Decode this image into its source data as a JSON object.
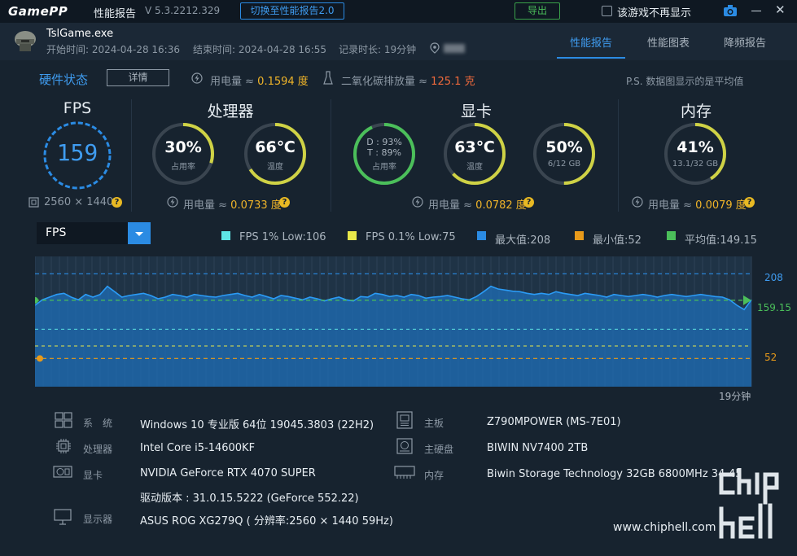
{
  "titlebar": {
    "logo": "GamePP",
    "title": "性能报告",
    "version": "V 5.3.2212.329",
    "switch_label": "切换至性能报告2.0",
    "export_label": "导出",
    "no_show_label": "该游戏不再显示"
  },
  "game": {
    "name": "TslGame.exe",
    "start": "开始时间: 2024-04-28 16:36",
    "end": "结束时间: 2024-04-28 16:55",
    "duration": "记录时长: 19分钟"
  },
  "tabs": [
    "性能报告",
    "性能图表",
    "降频报告"
  ],
  "summary": {
    "hw_title": "硬件状态",
    "detail_label": "详情",
    "power_label": "用电量 ≈",
    "power_value": "0.1594 度",
    "co2_label": "二氧化碳排放量 ≈",
    "co2_value": "125.1 克",
    "note": "P.S. 数据图显示的是平均值"
  },
  "fps": {
    "title": "FPS",
    "value": "159",
    "resolution": "2560 × 1440"
  },
  "cpu": {
    "title": "处理器",
    "usage_value": "30%",
    "usage_label": "占用率",
    "usage_pct": 30,
    "temp_value": "66℃",
    "temp_label": "温度",
    "temp_pct": 66,
    "energy_label": "用电量 ≈",
    "energy_value": "0.0733 度"
  },
  "gpu": {
    "title": "显卡",
    "d_line": "D : 93%",
    "t_line": "T : 89%",
    "usage_label": "占用率",
    "d_pct": 93,
    "t_pct": 89,
    "temp_value": "63℃",
    "temp_label": "温度",
    "temp_pct": 63,
    "vram_value": "50%",
    "vram_label": "6/12 GB",
    "vram_pct": 50,
    "energy_label": "用电量 ≈",
    "energy_value": "0.0782 度"
  },
  "mem": {
    "title": "内存",
    "value": "41%",
    "label": "13.1/32 GB",
    "pct": 41,
    "energy_label": "用电量 ≈",
    "energy_value": "0.0079 度"
  },
  "chart_panel": {
    "dropdown": "FPS",
    "legend": [
      {
        "label": "FPS 1% Low:106",
        "color": "#5ee6e6"
      },
      {
        "label": "FPS 0.1% Low:75",
        "color": "#e8e84a"
      },
      {
        "label": "最大值:208",
        "color": "#2b8be3"
      },
      {
        "label": "最小值:52",
        "color": "#e89a1a"
      },
      {
        "label": "平均值:149.15",
        "color": "#4bbf5a"
      }
    ],
    "max_label": "208",
    "avg_label": "159.15",
    "min_label": "52",
    "duration_label": "19分钟"
  },
  "chart_data": {
    "type": "area",
    "series": [
      {
        "name": "FPS",
        "values": [
          150,
          160,
          165,
          170,
          172,
          165,
          160,
          170,
          165,
          170,
          185,
          175,
          165,
          168,
          170,
          172,
          168,
          162,
          165,
          170,
          168,
          165,
          170,
          168,
          166,
          165,
          168,
          170,
          172,
          168,
          165,
          170,
          166,
          162,
          168,
          166,
          163,
          160,
          165,
          162,
          158,
          162,
          165,
          160,
          158,
          166,
          165,
          172,
          170,
          166,
          168,
          165,
          170,
          168,
          163,
          165,
          166,
          168,
          165,
          162,
          160,
          166,
          175,
          185,
          180,
          178,
          176,
          175,
          172,
          170,
          172,
          170,
          175,
          172,
          170,
          168,
          172,
          170,
          168,
          165,
          170,
          168,
          166,
          168,
          170,
          168,
          165,
          168,
          170,
          168,
          166,
          168,
          170,
          168,
          166,
          165,
          160,
          150,
          142,
          160
        ]
      }
    ],
    "reference_lines": {
      "max": 208,
      "avg": 159.15,
      "min": 52,
      "low_1": 106,
      "low_01": 75
    },
    "ylim": [
      0,
      240
    ]
  },
  "specs": [
    {
      "label": "系　统",
      "value": "Windows 10 专业版 64位 19045.3803 (22H2)"
    },
    {
      "label": "处理器",
      "value": "Intel Core i5-14600KF"
    },
    {
      "label": "显卡",
      "value": "NVIDIA GeForce RTX 4070 SUPER"
    },
    {
      "label": "",
      "value": "驱动版本 : 31.0.15.5222 (GeForce 552.22)"
    },
    {
      "label": "显示器",
      "value": "ASUS ROG XG279Q ( 分辨率:2560 × 1440 59Hz)"
    },
    {
      "label": "主板",
      "value": "Z790MPOWER (MS-7E01)"
    },
    {
      "label": "主硬盘",
      "value": "BIWIN NV7400 2TB"
    },
    {
      "label": "内存",
      "value": "Biwin Storage Technology 32GB 6800MHz 34-45"
    }
  ],
  "watermark": {
    "site": "www.chiphell.com",
    "logo_text": "chip hell"
  },
  "colors": {
    "accent": "#2b8be3",
    "background": "#17232f",
    "good": "#4bbf5a",
    "warn": "#e8b923"
  }
}
